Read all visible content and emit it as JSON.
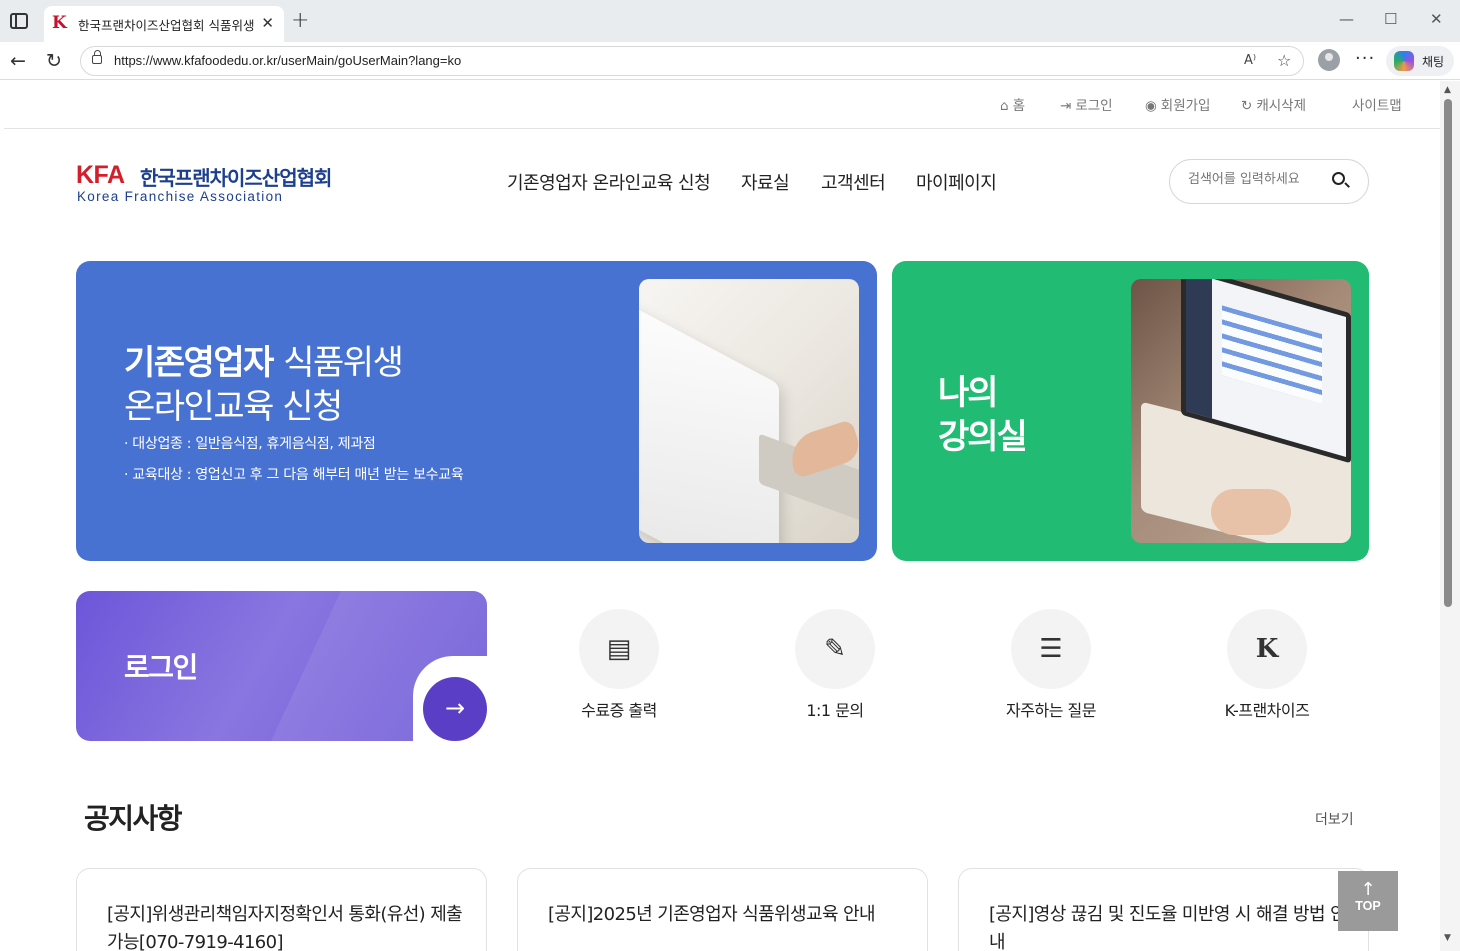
{
  "browser": {
    "tab_title": "한국프랜차이즈산업협회 식품위생",
    "url": "https://www.kfafoodedu.or.kr/userMain/goUserMain?lang=ko",
    "copilot_label": "채팅"
  },
  "util_nav": {
    "home": "홈",
    "login": "로그인",
    "signup": "회원가입",
    "cache_clear": "캐시삭제",
    "sitemap": "사이트맵"
  },
  "logo": {
    "abbr": "KFA",
    "korean": "한국프랜차이즈산업협회",
    "english": "Korea Franchise Association"
  },
  "gnb": [
    "기존영업자 온라인교육 신청",
    "자료실",
    "고객센터",
    "마이페이지"
  ],
  "search": {
    "placeholder": "검색어를 입력하세요"
  },
  "hero_blue": {
    "title_bold": "기존영업자",
    "title_rest": "식품위생",
    "title_line2": "온라인교육 신청",
    "line1": "· 대상업종 :  일반음식점, 휴게음식점, 제과점",
    "line2": "· 교육대상 :  영업신고 후 그 다음 해부터 매년 받는 보수교육"
  },
  "hero_green": {
    "line1": "나의",
    "line2": "강의실"
  },
  "login_card": {
    "label": "로그인"
  },
  "quick_links": [
    {
      "label": "수료증 출력",
      "icon": "certificate-icon"
    },
    {
      "label": "1:1 문의",
      "icon": "edit-icon"
    },
    {
      "label": "자주하는 질문",
      "icon": "chat-icon"
    },
    {
      "label": "K-프랜차이즈",
      "icon": "k-franchise-logo"
    }
  ],
  "notices": {
    "title": "공지사항",
    "more": "더보기",
    "items": [
      {
        "title": "[공지]위생관리책임자지정확인서 통화(유선) 제출 가능[070-7919-4160]"
      },
      {
        "title": "[공지]2025년 기존영업자 식품위생교육 안내"
      },
      {
        "title": "[공지]영상 끊김 및 진도율 미반영 시 해결 방법 안내"
      }
    ]
  },
  "top_button": {
    "label": "TOP"
  },
  "colors": {
    "blue_banner": "#4872d1",
    "green_banner": "#21bb73",
    "purple_card": "#6d56d9",
    "logo_red": "#d21f2b",
    "logo_navy": "#1d3f8f"
  }
}
